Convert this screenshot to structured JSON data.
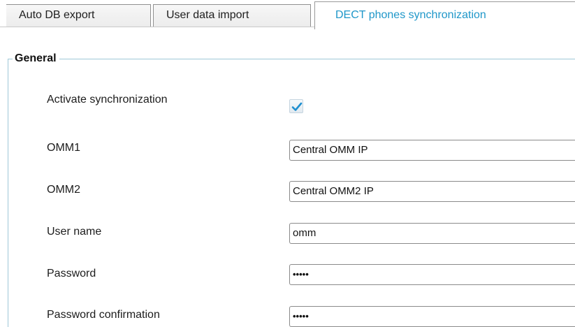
{
  "tabs": [
    {
      "label": "Auto DB export",
      "active": false
    },
    {
      "label": "User data import",
      "active": false
    },
    {
      "label": "DECT phones synchronization",
      "active": true
    }
  ],
  "colors": {
    "active_tab_text": "#1f97c9",
    "fieldset_border": "#9fc8d8",
    "checkmark": "#1e8fd0"
  },
  "general": {
    "legend": "General",
    "activate": {
      "label": "Activate synchronization",
      "checked": true,
      "icon": "checkmark-icon"
    },
    "omm1": {
      "label": "OMM1",
      "value": "Central OMM IP"
    },
    "omm2": {
      "label": "OMM2",
      "value": "Central OMM2 IP"
    },
    "user_name": {
      "label": "User name",
      "value": "omm"
    },
    "password": {
      "label": "Password",
      "value": "•••••"
    },
    "password_confirmation": {
      "label": "Password confirmation",
      "value": "•••••"
    }
  }
}
